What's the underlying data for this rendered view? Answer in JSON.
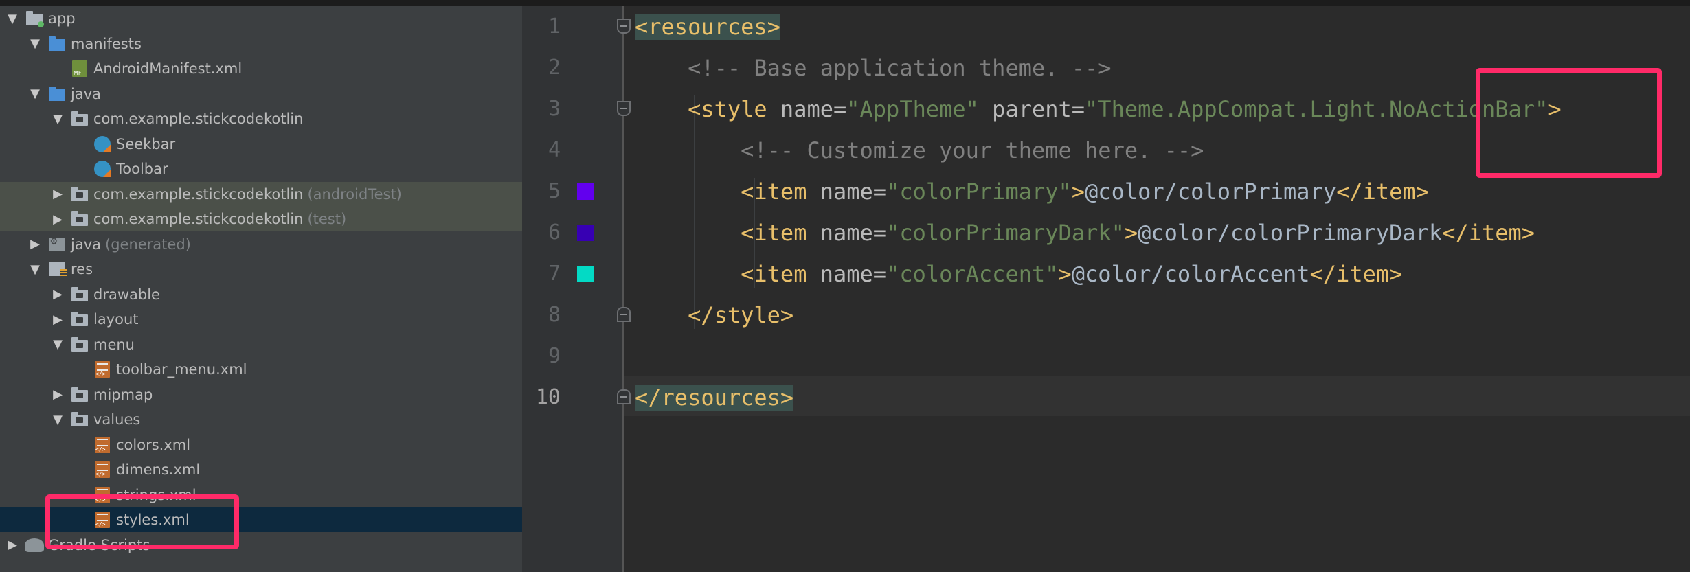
{
  "tree": {
    "rows": [
      {
        "label": "app",
        "muted": "",
        "depth": 0,
        "arrow": "down",
        "icon": "module-folder-icon",
        "state": ""
      },
      {
        "label": "manifests",
        "muted": "",
        "depth": 1,
        "arrow": "down",
        "icon": "blue-folder-icon",
        "state": ""
      },
      {
        "label": "AndroidManifest.xml",
        "muted": "",
        "depth": 2,
        "arrow": "none",
        "icon": "manifest-file-icon",
        "state": ""
      },
      {
        "label": "java",
        "muted": "",
        "depth": 1,
        "arrow": "down",
        "icon": "blue-folder-icon",
        "state": ""
      },
      {
        "label": "com.example.stickcodekotlin",
        "muted": "",
        "depth": 2,
        "arrow": "down",
        "icon": "package-icon",
        "state": ""
      },
      {
        "label": "Seekbar",
        "muted": "",
        "depth": 3,
        "arrow": "none",
        "icon": "kotlin-class-icon",
        "state": ""
      },
      {
        "label": "Toolbar",
        "muted": "",
        "depth": 3,
        "arrow": "none",
        "icon": "kotlin-class-icon",
        "state": ""
      },
      {
        "label": "com.example.stickcodekotlin",
        "muted": "(androidTest)",
        "depth": 2,
        "arrow": "right",
        "icon": "package-icon",
        "state": "hl"
      },
      {
        "label": "com.example.stickcodekotlin",
        "muted": "(test)",
        "depth": 2,
        "arrow": "right",
        "icon": "package-icon",
        "state": "hl"
      },
      {
        "label": "java",
        "muted": "(generated)",
        "depth": 1,
        "arrow": "right",
        "icon": "generated-folder-icon",
        "state": ""
      },
      {
        "label": "res",
        "muted": "",
        "depth": 1,
        "arrow": "down",
        "icon": "res-folder-icon",
        "state": ""
      },
      {
        "label": "drawable",
        "muted": "",
        "depth": 2,
        "arrow": "right",
        "icon": "package-icon",
        "state": ""
      },
      {
        "label": "layout",
        "muted": "",
        "depth": 2,
        "arrow": "right",
        "icon": "package-icon",
        "state": ""
      },
      {
        "label": "menu",
        "muted": "",
        "depth": 2,
        "arrow": "down",
        "icon": "package-icon",
        "state": ""
      },
      {
        "label": "toolbar_menu.xml",
        "muted": "",
        "depth": 3,
        "arrow": "none",
        "icon": "xml-file-icon",
        "state": ""
      },
      {
        "label": "mipmap",
        "muted": "",
        "depth": 2,
        "arrow": "right",
        "icon": "package-icon",
        "state": ""
      },
      {
        "label": "values",
        "muted": "",
        "depth": 2,
        "arrow": "down",
        "icon": "package-icon",
        "state": ""
      },
      {
        "label": "colors.xml",
        "muted": "",
        "depth": 3,
        "arrow": "none",
        "icon": "xml-file-icon",
        "state": ""
      },
      {
        "label": "dimens.xml",
        "muted": "",
        "depth": 3,
        "arrow": "none",
        "icon": "xml-file-icon",
        "state": ""
      },
      {
        "label": "strings.xml",
        "muted": "",
        "depth": 3,
        "arrow": "none",
        "icon": "xml-file-icon",
        "state": ""
      },
      {
        "label": "styles.xml",
        "muted": "",
        "depth": 3,
        "arrow": "none",
        "icon": "xml-file-icon",
        "state": "sel"
      },
      {
        "label": "Gradle Scripts",
        "muted": "",
        "depth": 0,
        "arrow": "right",
        "icon": "gradle-icon",
        "state": ""
      }
    ]
  },
  "editor": {
    "line_numbers": [
      "1",
      "2",
      "3",
      "4",
      "5",
      "6",
      "7",
      "8",
      "9",
      "10"
    ],
    "swatches": [
      {
        "line": 5,
        "color": "#6200ee"
      },
      {
        "line": 6,
        "color": "#3700b3"
      },
      {
        "line": 7,
        "color": "#03dac5"
      }
    ],
    "lines": [
      [
        {
          "t": "tag-hl",
          "s": "<resources>"
        }
      ],
      [
        {
          "t": "cmt",
          "s": "    <!-- Base application theme. -->"
        }
      ],
      [
        {
          "t": "tag",
          "s": "    <style "
        },
        {
          "t": "attr",
          "s": "name="
        },
        {
          "t": "val",
          "s": "\"AppTheme\""
        },
        {
          "t": "attr",
          "s": " parent="
        },
        {
          "t": "val",
          "s": "\"Theme.AppCompat.Light.NoActionBar\""
        },
        {
          "t": "tag",
          "s": ">"
        }
      ],
      [
        {
          "t": "cmt",
          "s": "        <!-- Customize your theme here. -->"
        }
      ],
      [
        {
          "t": "tag",
          "s": "        <item "
        },
        {
          "t": "attr",
          "s": "name="
        },
        {
          "t": "val",
          "s": "\"colorPrimary\""
        },
        {
          "t": "tag",
          "s": ">"
        },
        {
          "t": "txt",
          "s": "@color/colorPrimary"
        },
        {
          "t": "tag",
          "s": "</item>"
        }
      ],
      [
        {
          "t": "tag",
          "s": "        <item "
        },
        {
          "t": "attr",
          "s": "name="
        },
        {
          "t": "val",
          "s": "\"colorPrimaryDark\""
        },
        {
          "t": "tag",
          "s": ">"
        },
        {
          "t": "txt",
          "s": "@color/colorPrimaryDark"
        },
        {
          "t": "tag",
          "s": "</item>"
        }
      ],
      [
        {
          "t": "tag",
          "s": "        <item "
        },
        {
          "t": "attr",
          "s": "name="
        },
        {
          "t": "val",
          "s": "\"colorAccent\""
        },
        {
          "t": "tag",
          "s": ">"
        },
        {
          "t": "txt",
          "s": "@color/colorAccent"
        },
        {
          "t": "tag",
          "s": "</item>"
        }
      ],
      [
        {
          "t": "tag",
          "s": "    </style>"
        }
      ],
      [
        {
          "t": "txt",
          "s": ""
        }
      ],
      [
        {
          "t": "tag-hl",
          "s": "</resources>"
        }
      ]
    ]
  },
  "colors": {
    "callout": "#ff2a68",
    "tag": "#e8bf6a",
    "value": "#6a8759",
    "comment": "#808080"
  }
}
